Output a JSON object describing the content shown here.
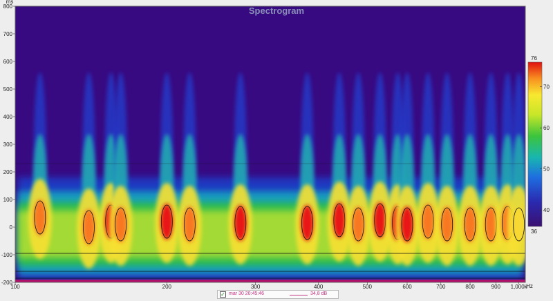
{
  "chart_data": {
    "type": "heatmap",
    "title": "Spectrogram",
    "x_unit": "Hz",
    "y_unit": "ms",
    "x_scale": "log",
    "xlim": [
      100,
      1030
    ],
    "ylim": [
      -200,
      800
    ],
    "x_ticks": [
      {
        "value": 100,
        "label": "100"
      },
      {
        "value": 200,
        "label": "200"
      },
      {
        "value": 300,
        "label": "300"
      },
      {
        "value": 400,
        "label": "400"
      },
      {
        "value": 500,
        "label": "500"
      },
      {
        "value": 600,
        "label": "600"
      },
      {
        "value": 700,
        "label": "700"
      },
      {
        "value": 800,
        "label": "800"
      },
      {
        "value": 900,
        "label": "900"
      },
      {
        "value": 1000,
        "label": "1,000k"
      }
    ],
    "y_ticks": [
      -200,
      -100,
      0,
      100,
      200,
      300,
      400,
      500,
      600,
      700,
      800
    ],
    "colorbar": {
      "min": 36,
      "max": 76,
      "ticks": [
        40,
        50,
        60,
        70
      ],
      "top_label": "76",
      "bottom_label": "36"
    },
    "peaks": [
      {
        "x": 112,
        "t": 35,
        "level": 72
      },
      {
        "x": 140,
        "t": 0,
        "level": 71
      },
      {
        "x": 155,
        "t": 20,
        "level": 75
      },
      {
        "x": 162,
        "t": 10,
        "level": 70
      },
      {
        "x": 200,
        "t": 20,
        "level": 73
      },
      {
        "x": 222,
        "t": 10,
        "level": 72
      },
      {
        "x": 280,
        "t": 15,
        "level": 76
      },
      {
        "x": 380,
        "t": 15,
        "level": 74
      },
      {
        "x": 440,
        "t": 25,
        "level": 76
      },
      {
        "x": 480,
        "t": 10,
        "level": 70
      },
      {
        "x": 530,
        "t": 25,
        "level": 74
      },
      {
        "x": 575,
        "t": 15,
        "level": 75
      },
      {
        "x": 600,
        "t": 10,
        "level": 75
      },
      {
        "x": 660,
        "t": 20,
        "level": 72
      },
      {
        "x": 720,
        "t": 10,
        "level": 70
      },
      {
        "x": 800,
        "t": 10,
        "level": 70
      },
      {
        "x": 880,
        "t": 10,
        "level": 70
      },
      {
        "x": 950,
        "t": 15,
        "level": 69
      },
      {
        "x": 1000,
        "t": 10,
        "level": 68
      }
    ],
    "legend": {
      "name": "mar 30 20:45:46",
      "value": "34,8 dB",
      "checked": true,
      "color": "#c03080"
    }
  }
}
